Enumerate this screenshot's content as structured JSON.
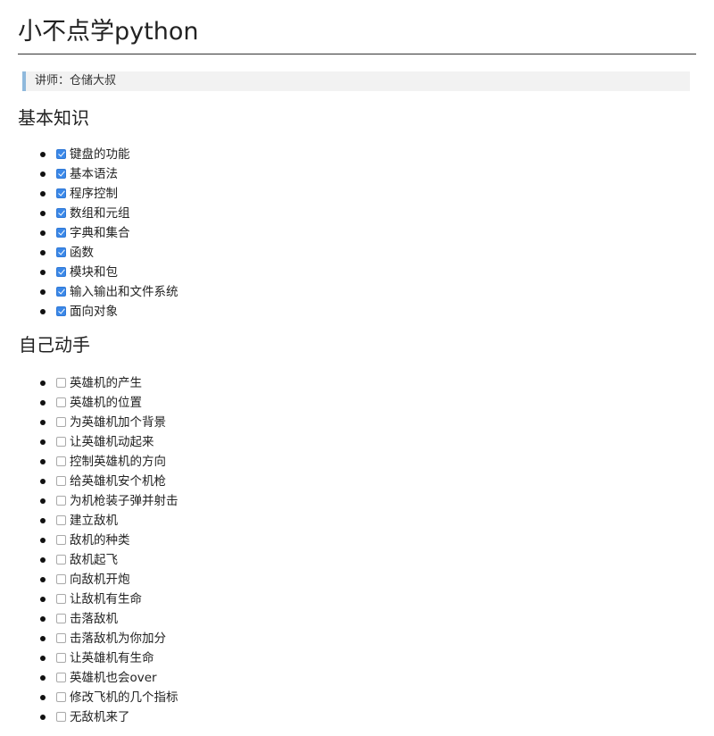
{
  "title": "小不点学python",
  "instructor": "讲师：仓储大叔",
  "sections": [
    {
      "heading": "基本知识",
      "items": [
        {
          "label": "键盘的功能",
          "checked": true
        },
        {
          "label": "基本语法",
          "checked": true
        },
        {
          "label": "程序控制",
          "checked": true
        },
        {
          "label": "数组和元组",
          "checked": true
        },
        {
          "label": "字典和集合",
          "checked": true
        },
        {
          "label": "函数",
          "checked": true
        },
        {
          "label": "模块和包",
          "checked": true
        },
        {
          "label": "输入输出和文件系统",
          "checked": true
        },
        {
          "label": "面向对象",
          "checked": true
        }
      ]
    },
    {
      "heading": "自己动手",
      "items": [
        {
          "label": "英雄机的产生",
          "checked": false
        },
        {
          "label": "英雄机的位置",
          "checked": false
        },
        {
          "label": "为英雄机加个背景",
          "checked": false
        },
        {
          "label": "让英雄机动起来",
          "checked": false
        },
        {
          "label": "控制英雄机的方向",
          "checked": false
        },
        {
          "label": "给英雄机安个机枪",
          "checked": false
        },
        {
          "label": "为机枪装子弹并射击",
          "checked": false
        },
        {
          "label": "建立敌机",
          "checked": false
        },
        {
          "label": "敌机的种类",
          "checked": false
        },
        {
          "label": "敌机起飞",
          "checked": false
        },
        {
          "label": "向敌机开炮",
          "checked": false
        },
        {
          "label": "让敌机有生命",
          "checked": false
        },
        {
          "label": "击落敌机",
          "checked": false
        },
        {
          "label": "击落敌机为你加分",
          "checked": false
        },
        {
          "label": "让英雄机有生命",
          "checked": false
        },
        {
          "label": "英雄机也会over",
          "checked": false
        },
        {
          "label": "修改飞机的几个指标",
          "checked": false
        },
        {
          "label": "无敌机来了",
          "checked": false
        }
      ]
    }
  ],
  "colors": {
    "checkbox_checked": "#3b88e8",
    "quote_border": "#8fb9dc",
    "quote_background": "#f2f2f2"
  },
  "icons": {
    "checked": "checkbox-checked-icon",
    "unchecked": "checkbox-unchecked-icon"
  }
}
